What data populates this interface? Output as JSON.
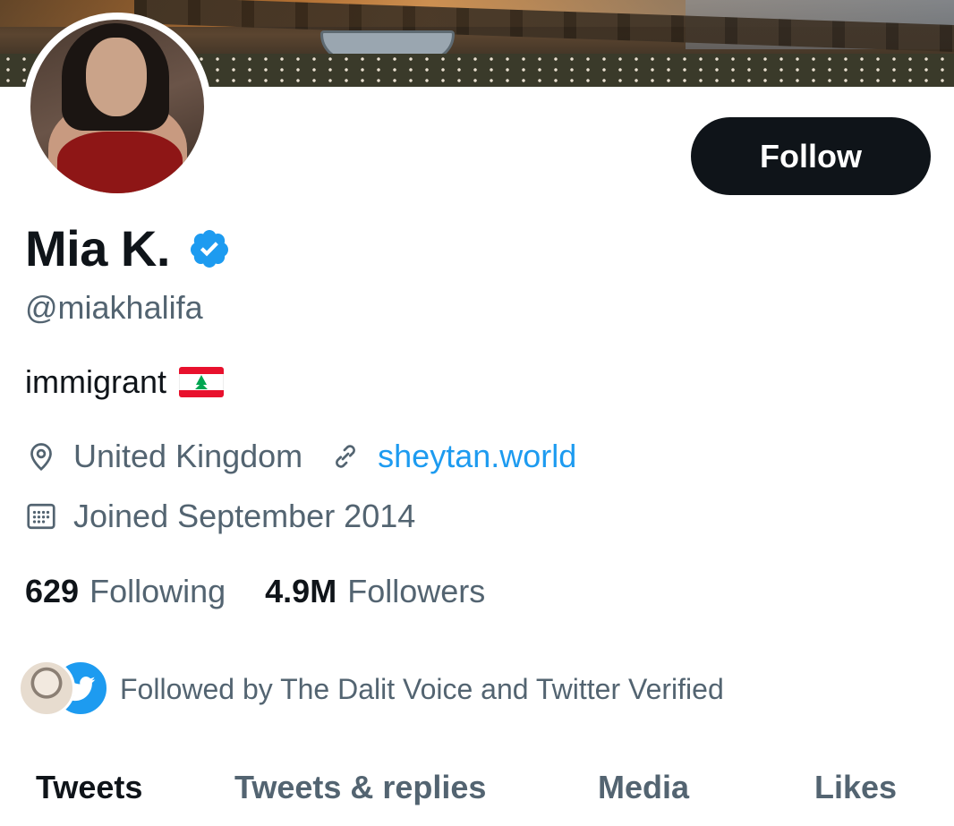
{
  "profile": {
    "follow_label": "Follow",
    "display_name": "Mia K.",
    "handle": "@miakhalifa",
    "bio": "immigrant",
    "location": "United Kingdom",
    "website": "sheytan.world",
    "joined": "Joined September 2014",
    "following_count": "629",
    "following_label": "Following",
    "followers_count": "4.9M",
    "followers_label": "Followers",
    "followed_by": "Followed by The Dalit Voice and Twitter Verified"
  },
  "tabs": [
    {
      "label": "Tweets",
      "active": true
    },
    {
      "label": "Tweets & replies",
      "active": false
    },
    {
      "label": "Media",
      "active": false
    },
    {
      "label": "Likes",
      "active": false
    }
  ],
  "colors": {
    "accent": "#1d9bf0",
    "text": "#0f1419",
    "muted": "#536471"
  },
  "icons": [
    "verified-badge-icon",
    "location-pin-icon",
    "link-icon",
    "calendar-icon",
    "lebanon-flag-icon",
    "twitter-bird-icon"
  ]
}
